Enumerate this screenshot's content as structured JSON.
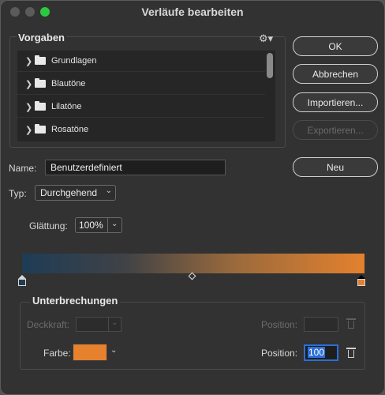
{
  "window": {
    "title": "Verläufe bearbeiten"
  },
  "presets": {
    "label": "Vorgaben",
    "items": [
      {
        "label": "Grundlagen"
      },
      {
        "label": "Blautöne"
      },
      {
        "label": "Lilatöne"
      },
      {
        "label": "Rosatöne"
      }
    ]
  },
  "buttons": {
    "ok": "OK",
    "cancel": "Abbrechen",
    "import": "Importieren...",
    "export": "Exportieren...",
    "new": "Neu"
  },
  "name": {
    "label": "Name:",
    "value": "Benutzerdefiniert"
  },
  "type": {
    "label": "Typ:",
    "value": "Durchgehend"
  },
  "smoothing": {
    "label": "Glättung:",
    "value": "100%"
  },
  "gradient": {
    "start_color": "#1e3c56",
    "end_color": "#e4812e"
  },
  "breaks": {
    "label": "Unterbrechungen",
    "opacity_label": "Deckkraft:",
    "opacity_position_label": "Position:",
    "color_label": "Farbe:",
    "color_value": "#e6812d",
    "color_position_label": "Position:",
    "color_position_value": "100"
  }
}
